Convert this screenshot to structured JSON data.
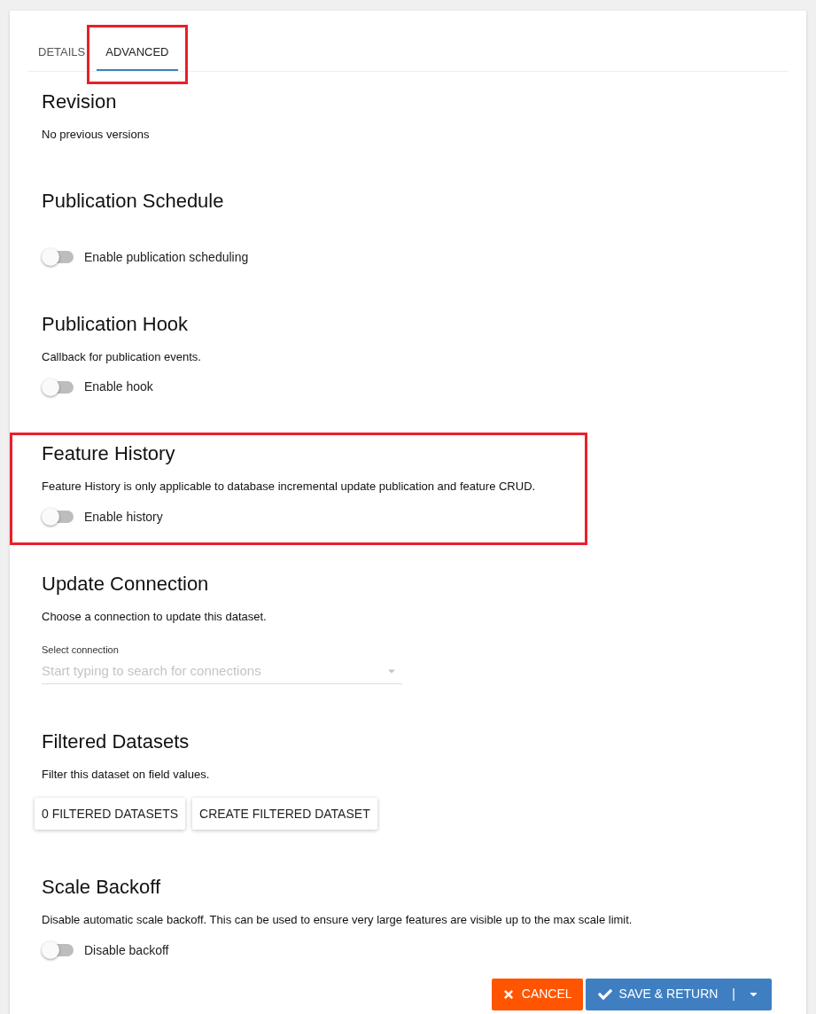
{
  "tabs": [
    {
      "label": "DETAILS",
      "selected": false,
      "highlighted": false
    },
    {
      "label": "ADVANCED",
      "selected": true,
      "highlighted": true
    }
  ],
  "sections": [
    {
      "title": "Revision",
      "description": "No previous versions",
      "highlighted": false
    },
    {
      "title": "Publication Schedule",
      "toggle": {
        "label": "Enable publication scheduling",
        "on": false
      },
      "highlighted": false
    },
    {
      "title": "Publication Hook",
      "description": "Callback for publication events.",
      "toggle": {
        "label": "Enable hook",
        "on": false
      },
      "highlighted": false
    },
    {
      "title": "Feature History",
      "description": "Feature History is only applicable to database incremental update publication and feature CRUD.",
      "toggle": {
        "label": "Enable history",
        "on": false
      },
      "highlighted": true
    },
    {
      "title": "Update Connection",
      "description": "Choose a connection to update this dataset.",
      "select": {
        "label": "Select connection",
        "placeholder": "Start typing to search for connections"
      },
      "highlighted": false
    },
    {
      "title": "Filtered Datasets",
      "description": "Filter this dataset on field values.",
      "buttons": [
        "0 FILTERED DATASETS",
        "CREATE FILTERED DATASET"
      ],
      "highlighted": false
    },
    {
      "title": "Scale Backoff",
      "description": "Disable automatic scale backoff. This can be used to ensure very large features are visible up to the max scale limit.",
      "toggle": {
        "label": "Disable backoff",
        "on": false
      },
      "highlighted": false
    }
  ],
  "footer": {
    "cancel": "CANCEL",
    "save": "SAVE & RETURN",
    "separator": "|"
  }
}
